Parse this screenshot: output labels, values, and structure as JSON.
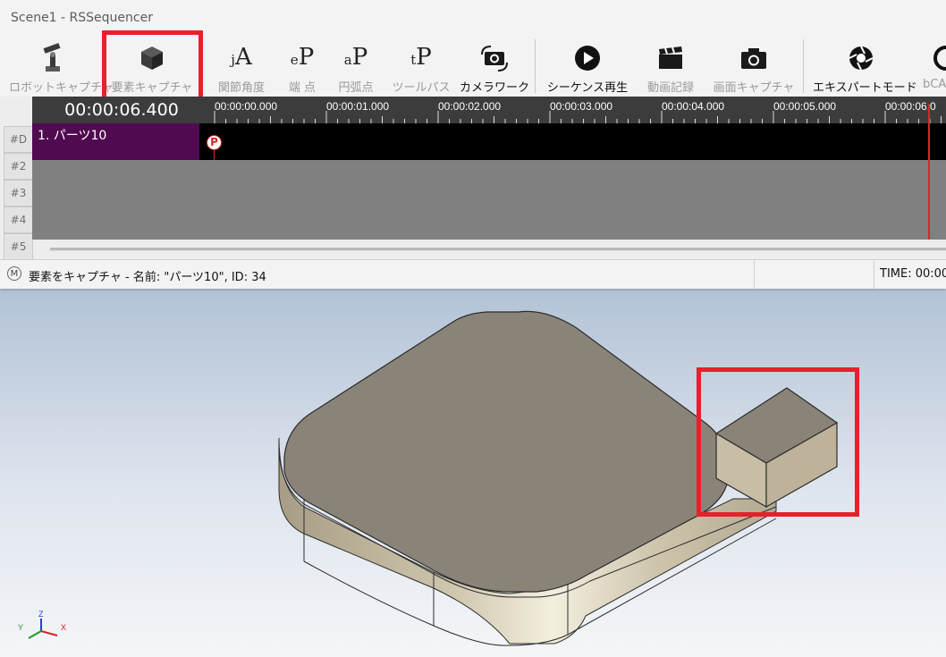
{
  "window": {
    "title": "Scene1 - RSSequencer"
  },
  "toolbar": {
    "buttons": [
      {
        "label": "ロボットキャプチャ",
        "icon": "robot-arm-icon",
        "enabled": false
      },
      {
        "label": "要素キャプチャ",
        "icon": "cube-icon",
        "enabled": false
      },
      {
        "label": "関節角度",
        "icon": "joint-angle-icon",
        "glyph": "jA",
        "enabled": false
      },
      {
        "label": "端 点",
        "icon": "end-point-icon",
        "glyph": "eP",
        "enabled": false
      },
      {
        "label": "円弧点",
        "icon": "arc-point-icon",
        "glyph": "aP",
        "enabled": false
      },
      {
        "label": "ツールパス",
        "icon": "tool-path-icon",
        "glyph": "tP",
        "enabled": false
      },
      {
        "label": "カメラワーク",
        "icon": "camera-work-icon",
        "enabled": true
      },
      {
        "label": "シーケンス再生",
        "icon": "play-icon",
        "enabled": true
      },
      {
        "label": "動画記録",
        "icon": "clapperboard-icon",
        "enabled": false
      },
      {
        "label": "画面キャプチャ",
        "icon": "camera-icon",
        "enabled": false
      },
      {
        "label": "エキスパートモード",
        "icon": "aperture-icon",
        "enabled": true
      },
      {
        "label": "bCA",
        "icon": "cut-off-icon",
        "enabled": false
      }
    ]
  },
  "timeline": {
    "current_time": "00:00:06.400",
    "ruler_labels": [
      "00:00:00.000",
      "00:00:01.000",
      "00:00:02.000",
      "00:00:03.000",
      "00:00:04.000",
      "00:00:05.000",
      "00:00:06.0"
    ],
    "rows": [
      "#D",
      "#2",
      "#3",
      "#4",
      "#5"
    ],
    "track1_clip": "1. パーツ10",
    "marker": "P"
  },
  "statusbar": {
    "mode": "M",
    "message": "要素をキャプチャ - 名前: \"パーツ10\", ID: 34",
    "time": "TIME: 00:00"
  },
  "viewport": {
    "axes": {
      "x": "X",
      "y": "Y",
      "z": "Z"
    }
  },
  "colors": {
    "highlight": "#e8202a",
    "playhead": "#e0222c",
    "clip": "#4f0a50",
    "part_top": "#8a8478",
    "part_side": "#b8ae98"
  }
}
